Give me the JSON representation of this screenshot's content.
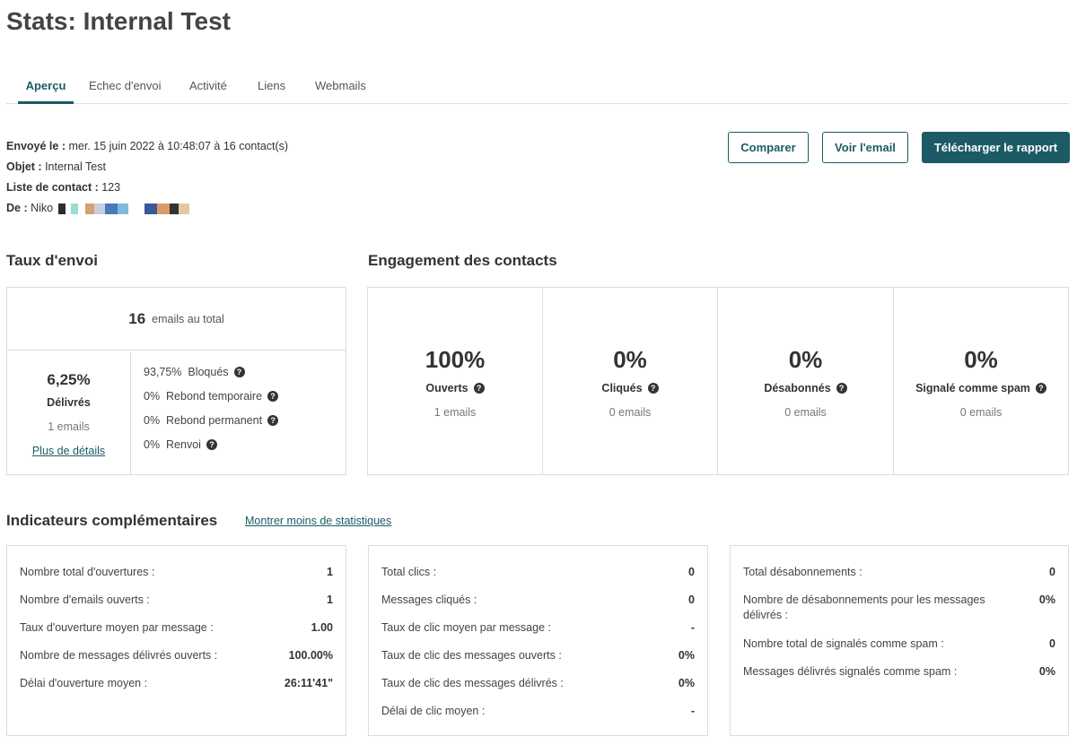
{
  "page": {
    "title": "Stats: Internal Test"
  },
  "tabs": [
    {
      "label": "Aperçu",
      "active": true
    },
    {
      "label": "Echec d'envoi"
    },
    {
      "label": "Activité"
    },
    {
      "label": "Liens"
    },
    {
      "label": "Webmails"
    }
  ],
  "meta": {
    "sent_label": "Envoyé le :",
    "sent_value": "mer. 15 juin 2022 à 10:48:07 à 16 contact(s)",
    "subject_label": "Objet :",
    "subject_value": "Internal Test",
    "list_label": "Liste de contact :",
    "list_value": "123",
    "from_label": "De :",
    "from_value": "Niko"
  },
  "actions": {
    "compare": "Comparer",
    "view_email": "Voir l'email",
    "download": "Télécharger le rapport"
  },
  "send_rate": {
    "title": "Taux d'envoi",
    "total_value": "16",
    "total_label": "emails au total",
    "delivered_pct": "6,25%",
    "delivered_label": "Délivrés",
    "delivered_count": "1 emails",
    "details_link": "Plus de détails",
    "rows": [
      {
        "pct": "93,75%",
        "label": "Bloqués"
      },
      {
        "pct": "0%",
        "label": "Rebond temporaire"
      },
      {
        "pct": "0%",
        "label": "Rebond permanent"
      },
      {
        "pct": "0%",
        "label": "Renvoi"
      }
    ]
  },
  "engagement": {
    "title": "Engagement des contacts",
    "cells": [
      {
        "pct": "100%",
        "label": "Ouverts",
        "count": "1 emails"
      },
      {
        "pct": "0%",
        "label": "Cliqués",
        "count": "0 emails"
      },
      {
        "pct": "0%",
        "label": "Désabonnés",
        "count": "0 emails"
      },
      {
        "pct": "0%",
        "label": "Signalé comme spam",
        "count": "0 emails"
      }
    ]
  },
  "indicators": {
    "title": "Indicateurs complémentaires",
    "toggle_link": "Montrer moins de statistiques",
    "opens": [
      {
        "k": "Nombre total d'ouvertures :",
        "v": "1"
      },
      {
        "k": "Nombre d'emails ouverts :",
        "v": "1"
      },
      {
        "k": "Taux d'ouverture moyen par message :",
        "v": "1.00"
      },
      {
        "k": "Nombre de messages délivrés ouverts :",
        "v": "100.00%"
      },
      {
        "k": "Délai d'ouverture moyen :",
        "v": "26:11'41\""
      }
    ],
    "clicks": [
      {
        "k": "Total clics :",
        "v": "0"
      },
      {
        "k": "Messages cliqués :",
        "v": "0"
      },
      {
        "k": "Taux de clic moyen par message :",
        "v": "-"
      },
      {
        "k": "Taux de clic des messages ouverts :",
        "v": "0%"
      },
      {
        "k": "Taux de clic des messages délivrés :",
        "v": "0%"
      },
      {
        "k": "Délai de clic moyen :",
        "v": "-"
      }
    ],
    "unsubs": [
      {
        "k": "Total désabonnements :",
        "v": "0"
      },
      {
        "k": "Nombre de désabonnements pour les messages délivrés :",
        "v": "0%"
      },
      {
        "k": "Nombre total de signalés comme spam :",
        "v": "0"
      },
      {
        "k": "Messages délivrés signalés comme spam :",
        "v": "0%"
      }
    ]
  },
  "icons": {
    "help": "help-circle-icon"
  },
  "colors": {
    "accent": "#1c5b66",
    "border": "#dcdcdc"
  }
}
